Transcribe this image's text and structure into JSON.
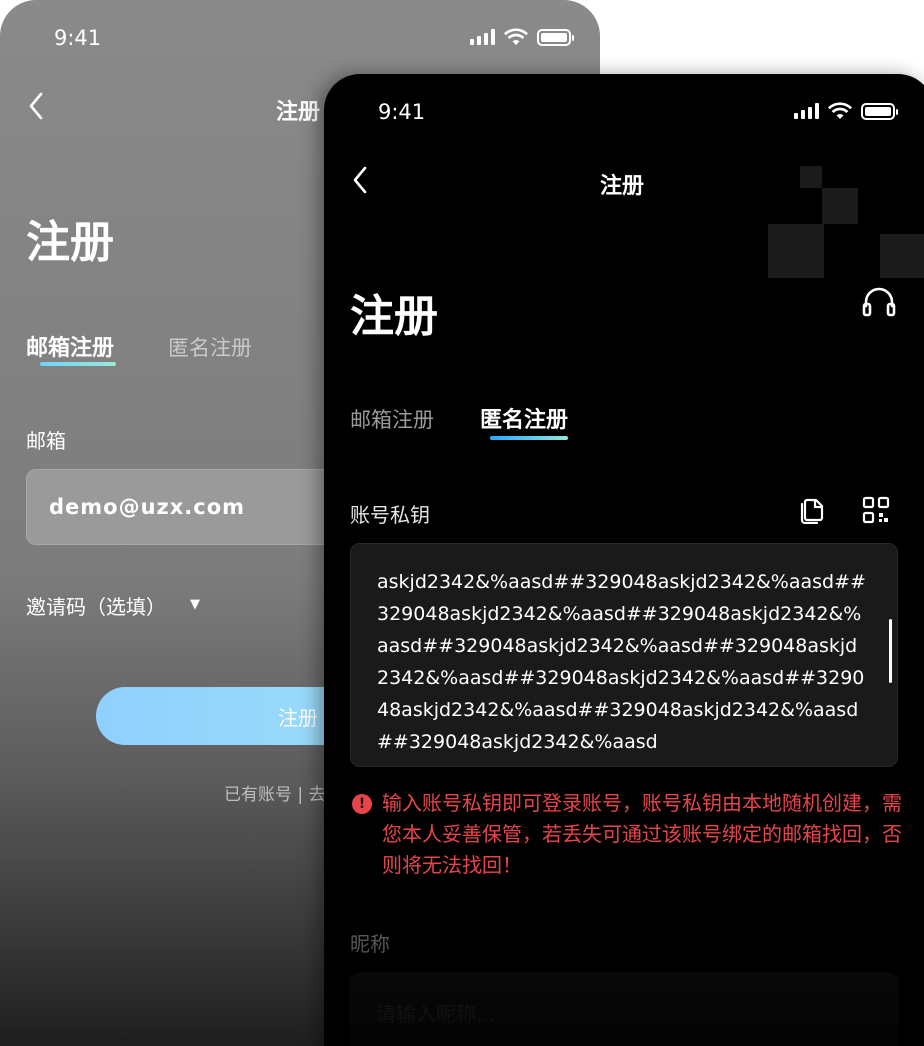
{
  "back_screen": {
    "status_time": "9:41",
    "nav_title": "注册",
    "page_title": "注册",
    "tabs": [
      {
        "label": "邮箱注册"
      },
      {
        "label": "匿名注册"
      }
    ],
    "email_label": "邮箱",
    "email_value": "demo@uzx.com",
    "invite_label": "邀请码（选填）",
    "submit_label": "注册",
    "footer_text": "已有账号 | 去"
  },
  "front_screen": {
    "status_time": "9:41",
    "nav_title": "注册",
    "page_title": "注册",
    "tabs": [
      {
        "label": "邮箱注册"
      },
      {
        "label": "匿名注册"
      }
    ],
    "private_key_label": "账号私钥",
    "private_key_value": "askjd2342&%aasd##329048askjd2342&%aasd##329048askjd2342&%aasd##329048askjd2342&%aasd##329048askjd2342&%aasd##329048askjd2342&%aasd##329048askjd2342&%aasd##329048askjd2342&%aasd##329048askjd2342&%aasd##329048askjd2342&%aasd",
    "warning_text": "输入账号私钥即可登录账号，账号私钥由本地随机创建，需您本人妥善保管，若丢失可通过该账号绑定的邮箱找回，否则将无法找回！",
    "nickname_label": "昵称",
    "nickname_placeholder": "请输入昵称..."
  },
  "colors": {
    "accent_gradient_start": "#2aa8ff",
    "accent_gradient_end": "#8fe7d8",
    "warning": "#e8454a",
    "front_bg": "#000000",
    "back_bg": "#8a8a8a"
  }
}
